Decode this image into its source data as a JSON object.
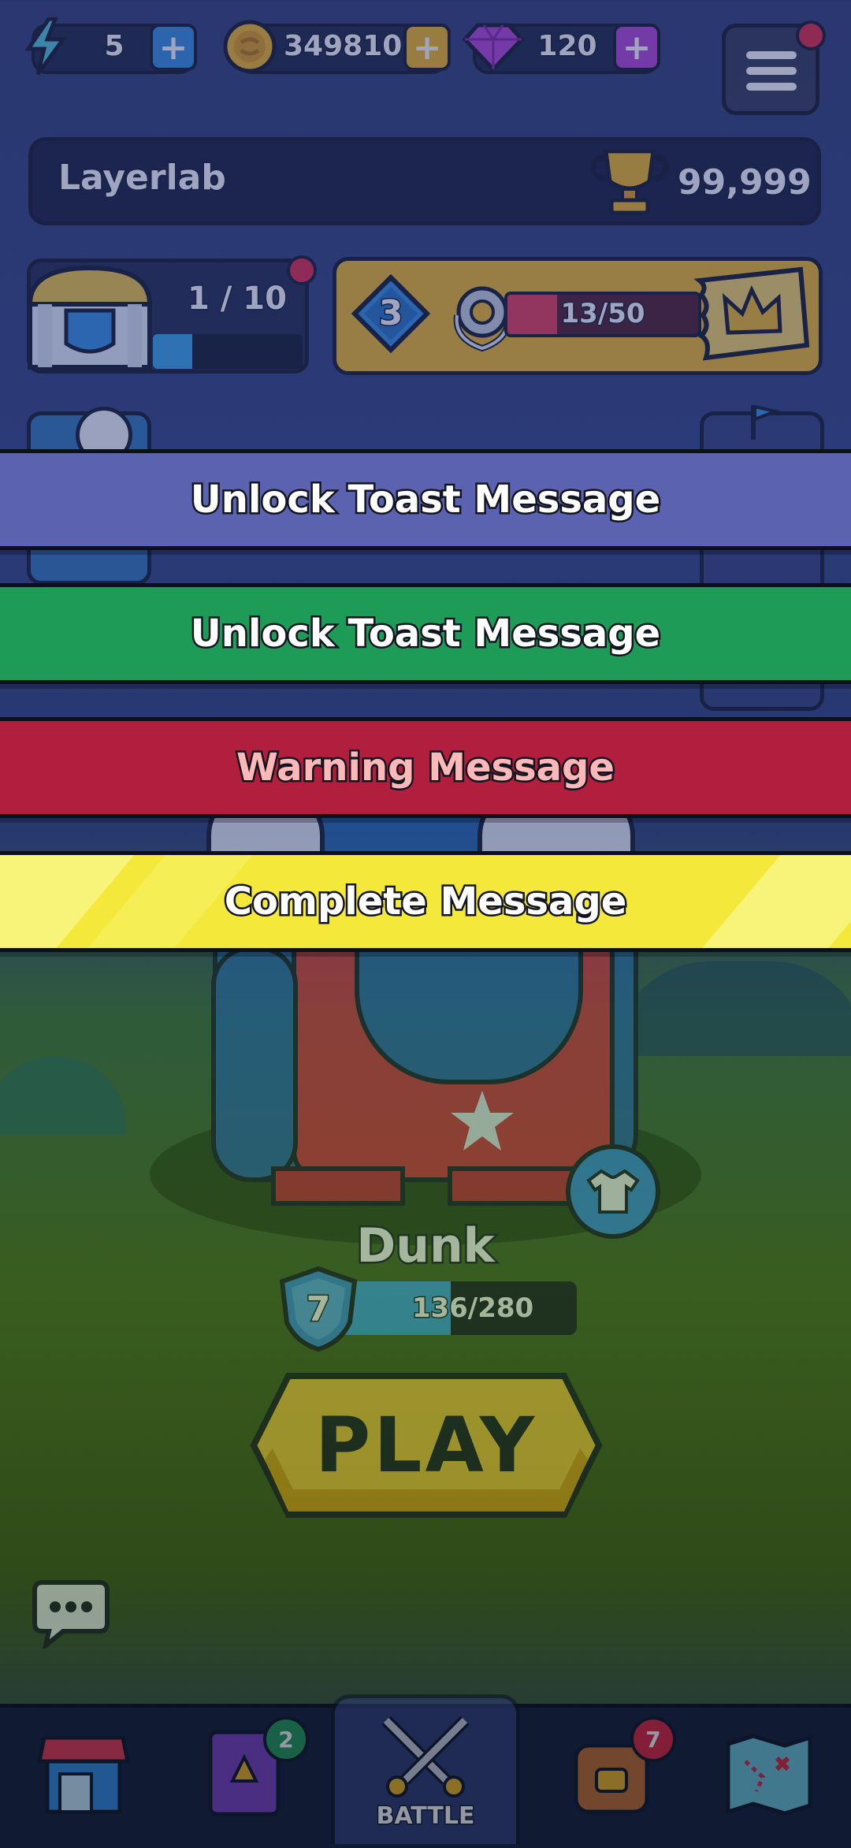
{
  "currencies": {
    "energy": "5",
    "coins": "349810",
    "gems": "120"
  },
  "profile": {
    "name": "Layerlab",
    "trophies": "99,999"
  },
  "chest": {
    "progress": "1 / 10"
  },
  "pass": {
    "level": "3",
    "progress": "13/50"
  },
  "toasts": [
    {
      "label": "Unlock Toast Message",
      "color": "#5b63b0"
    },
    {
      "label": "Unlock Toast Message",
      "color": "#1f9b58"
    },
    {
      "label": "Warning Message",
      "color": "#b21e3d",
      "text_color": "#ffb8b8"
    },
    {
      "label": "Complete Message",
      "color": "#f4e93b"
    }
  ],
  "character": {
    "name": "Dunk",
    "level": "7",
    "xp": "136/280",
    "xp_fraction": 0.486
  },
  "play_label": "PLAY",
  "nav": {
    "shop_label": "",
    "book_badge": "2",
    "battle_label": "BATTLE",
    "chest_badge": "7",
    "map_label": ""
  }
}
